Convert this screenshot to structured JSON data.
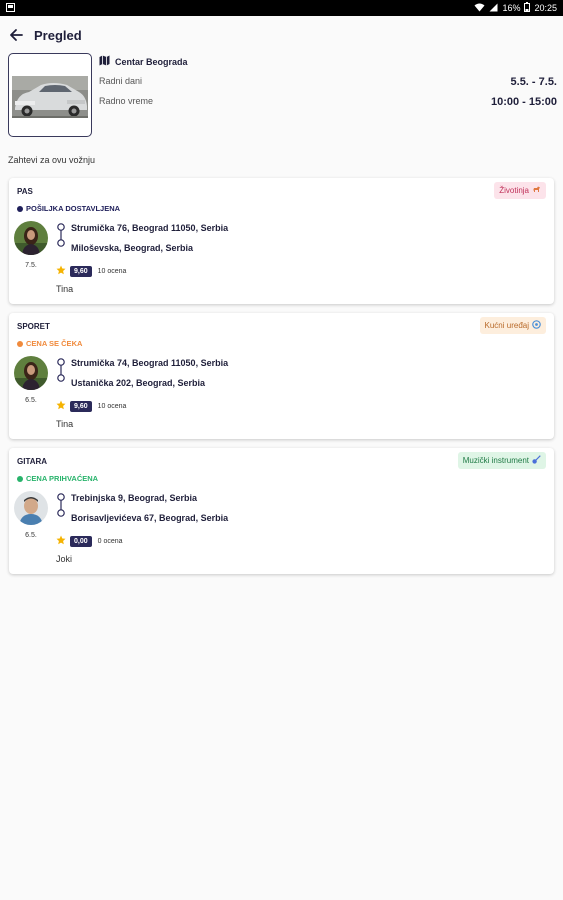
{
  "status_bar": {
    "battery": "16%",
    "time": "20:25"
  },
  "header": {
    "title": "Pregled"
  },
  "ride": {
    "location": "Centar Beograda",
    "days_label": "Radni dani",
    "days_value": "5.5. - 7.5.",
    "hours_label": "Radno vreme",
    "hours_value": "10:00 - 15:00"
  },
  "section_title": "Zahtevi za ovu vožnju",
  "requests": [
    {
      "name": "PAS",
      "tag": "Životinja",
      "tag_icon": "dog-icon",
      "status": "POŠILJKA DOSTAVLJENA",
      "status_color": "#1f1f5a",
      "tag_bg": "#fce3ea",
      "date": "7.5.",
      "from": "Strumička 76, Beograd 11050, Serbia",
      "to": "Miloševska, Beograd, Serbia",
      "score": "9,60",
      "ratings": "10 ocena",
      "person": "Tina"
    },
    {
      "name": "SPORET",
      "tag": "Kućni uređaj",
      "tag_icon": "appliance-icon",
      "status": "CENA SE ČEKA",
      "status_color": "#f08a3c",
      "tag_bg": "#fdeedd",
      "date": "6.5.",
      "from": "Strumička 74, Beograd 11050, Serbia",
      "to": "Ustanička 202, Beograd, Serbia",
      "score": "9,60",
      "ratings": "10 ocena",
      "person": "Tina"
    },
    {
      "name": "GITARA",
      "tag": "Muzički instrument",
      "tag_icon": "guitar-icon",
      "status": "CENA PRIHVAĆENA",
      "status_color": "#28b36b",
      "tag_bg": "#dff5e6",
      "date": "6.5.",
      "from": "Trebinjska 9, Beograd, Serbia",
      "to": "Borisavljevićeva 67, Beograd, Serbia",
      "score": "0,00",
      "ratings": "0 ocena",
      "person": "Joki"
    }
  ],
  "colors": {
    "accent": "#2b2a5a",
    "star": "#f5b301"
  }
}
